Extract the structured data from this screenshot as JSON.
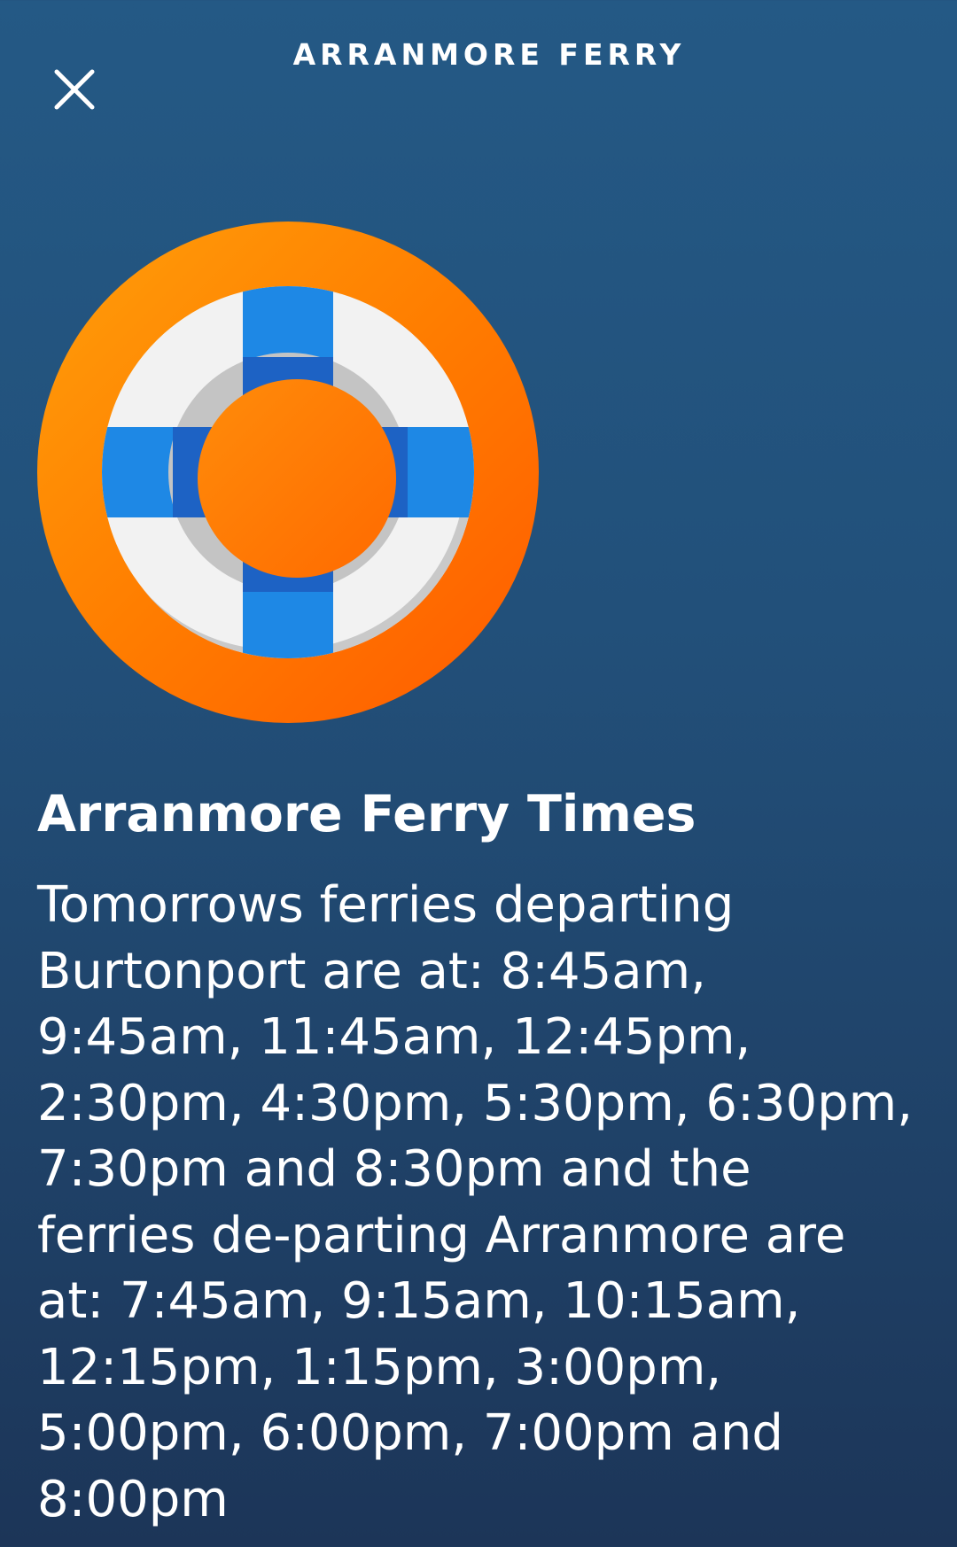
{
  "header": {
    "title": "ARRANMORE FERRY",
    "close_icon": "close-icon"
  },
  "hero": {
    "icon": "lifebuoy-icon",
    "colors": {
      "ring_outer": "#ff7a00",
      "ring_inner_white": "#f2f2f2",
      "stripes": "#1e88e5",
      "background_top": "#245985",
      "background_bottom": "#1c3558"
    }
  },
  "card": {
    "title": "Arranmore Ferry Times",
    "body": "Tomorrows ferries departing Burtonport are at: 8:45am, 9:45am, 11:45am, 12:45pm, 2:30pm, 4:30pm, 5:30pm, 6:30pm, 7:30pm and 8:30pm and the ferries de-parting Arranmore are at: 7:45am, 9:15am, 10:15am, 12:15pm, 1:15pm, 3:00pm, 5:00pm, 6:00pm, 7:00pm and 8:00pm"
  }
}
